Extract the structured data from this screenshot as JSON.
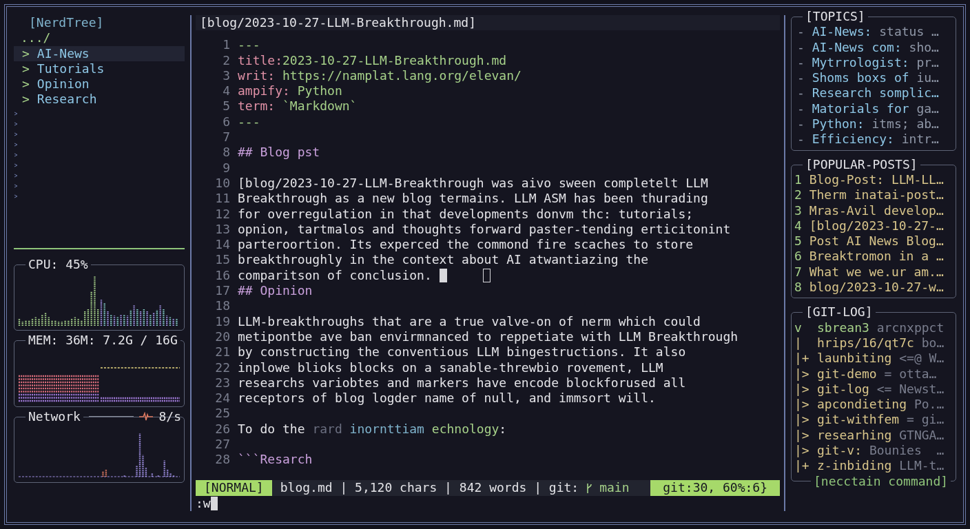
{
  "file_tree": {
    "title": "[NerdTree]",
    "parent": ".../",
    "items": [
      {
        "marker": ">",
        "label": "AI-News",
        "selected": true
      },
      {
        "marker": ">",
        "label": "Tutorials",
        "selected": false
      },
      {
        "marker": ">",
        "label": "Opinion",
        "selected": false
      },
      {
        "marker": ">",
        "label": "Research",
        "selected": false
      }
    ]
  },
  "monitors": [
    {
      "kind": "cpu",
      "title": "CPU: 45%"
    },
    {
      "kind": "mem",
      "title": "MEM: 36M: 7.2G / 16G"
    },
    {
      "kind": "network",
      "title": "Network",
      "reading": "8/s"
    }
  ],
  "editor": {
    "tab_title": "[blog/2023-10-27-LLM-Breakthrough.md]",
    "lines": [
      {
        "number": "1",
        "segments": [
          {
            "kind": "value",
            "text": "---"
          }
        ]
      },
      {
        "number": "2",
        "segments": [
          {
            "kind": "key",
            "text": "title:"
          },
          {
            "kind": "value",
            "text": "2023-10-27-LLM-Breakthrough.md"
          }
        ]
      },
      {
        "number": "3",
        "segments": [
          {
            "kind": "key",
            "text": "writ: "
          },
          {
            "kind": "value",
            "text": "https://namplat.lang.org/elevan/"
          }
        ]
      },
      {
        "number": "4",
        "segments": [
          {
            "kind": "key",
            "text": "ampify: "
          },
          {
            "kind": "value",
            "text": "Python"
          }
        ]
      },
      {
        "number": "5",
        "segments": [
          {
            "kind": "key",
            "text": "term: "
          },
          {
            "kind": "value",
            "text": "`Markdown`"
          }
        ]
      },
      {
        "number": "6",
        "segments": [
          {
            "kind": "value",
            "text": "---"
          }
        ]
      },
      {
        "number": "7"
      },
      {
        "number": "8",
        "segments": [
          {
            "kind": "heading",
            "text": "## Blog pst"
          }
        ]
      },
      {
        "number": "9"
      },
      {
        "number": "10",
        "segments": [
          {
            "kind": "text",
            "text": "[blog/2023-10-27-LLM-Breakthrough was aivo sween completelt LLM"
          }
        ]
      },
      {
        "number": "11",
        "segments": [
          {
            "kind": "text",
            "text": "Breakthrough as a new blog termains. LLM ASM has been thurading"
          }
        ]
      },
      {
        "number": "12",
        "segments": [
          {
            "kind": "text",
            "text": "for overregulation in that developments donvm thc: tutorials;"
          }
        ]
      },
      {
        "number": "13",
        "segments": [
          {
            "kind": "text",
            "text": "opnion, tartmalos and thoughts forward paster-tending erticitonint"
          }
        ]
      },
      {
        "number": "14",
        "segments": [
          {
            "kind": "text",
            "text": "parteroortion. Its experced the commond fire scaches to store"
          }
        ]
      },
      {
        "number": "15",
        "segments": [
          {
            "kind": "text",
            "text": "breakthroughly in the context about AI atwantiazing the"
          }
        ]
      },
      {
        "number": "16",
        "segments": [
          {
            "kind": "text",
            "text": "comparitson of conclusion. "
          },
          {
            "kind": "block-cursor"
          },
          {
            "kind": "hollow-cursor"
          }
        ]
      },
      {
        "number": "17",
        "segments": [
          {
            "kind": "heading",
            "text": "## Opinion"
          }
        ]
      },
      {
        "number": "18"
      },
      {
        "number": "19",
        "segments": [
          {
            "kind": "text",
            "text": "LLM-breakthroughs that are a true valve-on of nerm which could"
          }
        ]
      },
      {
        "number": "20",
        "segments": [
          {
            "kind": "text",
            "text": "metipontbe ave ban envirmnanced to reppetiate with LLM Breakthrough"
          }
        ]
      },
      {
        "number": "21",
        "segments": [
          {
            "kind": "text",
            "text": "by constructing the conventious LLM bingestructions. It also"
          }
        ]
      },
      {
        "number": "22",
        "segments": [
          {
            "kind": "text",
            "text": "inplowe blioks blocks on a sanable-threwbio rovement, LLM"
          }
        ]
      },
      {
        "number": "23",
        "segments": [
          {
            "kind": "text",
            "text": "researchs variobtes and markers have encode blockforused all"
          }
        ]
      },
      {
        "number": "24",
        "segments": [
          {
            "kind": "text",
            "text": "receptors of blog logder name of null, and immsort will."
          }
        ]
      },
      {
        "number": "25"
      },
      {
        "number": "26",
        "segments": [
          {
            "kind": "text",
            "text": "To do the "
          },
          {
            "kind": "faint",
            "text": "rard"
          },
          {
            "kind": "link",
            "text": " inornttiam"
          },
          {
            "kind": "value",
            "text": " echnology"
          },
          {
            "kind": "text",
            "text": ":"
          }
        ]
      },
      {
        "number": "27"
      },
      {
        "number": "28",
        "segments": [
          {
            "kind": "heading",
            "text": "```Resarch"
          }
        ]
      }
    ]
  },
  "status_bar": {
    "mode": "[NORMAL]",
    "info": "blog.md | 5,120 chars | 842 words | git:",
    "branch": "main",
    "position": "git:30, 60%:6}"
  },
  "command_line": {
    "text": ":w"
  },
  "topics": {
    "title": "[TOPICS]",
    "items": [
      {
        "marker": "-",
        "name": "AI-News:",
        "desc": "status …"
      },
      {
        "marker": "-",
        "name": "AI-News com:",
        "desc": "sho…"
      },
      {
        "marker": "-",
        "name": "Mytrrologist:",
        "desc": "pr…"
      },
      {
        "marker": "-",
        "name": "Shoms boxs of",
        "desc": "iu…"
      },
      {
        "marker": "-",
        "name": "Research somplic…"
      },
      {
        "marker": "-",
        "name": "Matorials for",
        "desc": "ga…"
      },
      {
        "marker": "-",
        "name": "Python:",
        "desc": "itms; ab…"
      },
      {
        "marker": "-",
        "name": "Efficiency:",
        "desc": "intr…"
      }
    ]
  },
  "popular_posts": {
    "title": "[POPULAR-POSTS]",
    "items": [
      {
        "number": "1",
        "text": "Blog-Post: LLM-LL…"
      },
      {
        "number": "2",
        "text": "Therm inatai-post…"
      },
      {
        "number": "3",
        "text": "Mras-Avil develop…"
      },
      {
        "number": "4",
        "text": "[blog/2023-10-27-…"
      },
      {
        "number": "5",
        "text": "Post AI News Blog…"
      },
      {
        "number": "6",
        "text": "Breaktromon in a …"
      },
      {
        "number": "7",
        "text": "What we we.ur am.…"
      },
      {
        "number": "8",
        "text": "blog/2023-10-27-w…"
      }
    ]
  },
  "git_log": {
    "title": "[GIT-LOG]",
    "items": [
      {
        "kind": "head",
        "graph": "v",
        "name": "sbrean3",
        "detail": "arcnxppct"
      },
      {
        "kind": "commit",
        "graph": "|",
        "name": "hrips/16/qt7c",
        "detail": "bo…"
      },
      {
        "kind": "commit",
        "graph": "|+",
        "name": "launbiting",
        "detail": "<=@ W…"
      },
      {
        "kind": "commit",
        "graph": "|>",
        "name": "git-demo",
        "detail": "= otta…"
      },
      {
        "kind": "commit",
        "graph": "|>",
        "name": "git-log",
        "detail": "<= Newst…"
      },
      {
        "kind": "commit",
        "graph": "|>",
        "name": "apcondieting",
        "detail": "Po.…"
      },
      {
        "kind": "commit",
        "graph": "|>",
        "name": "git-withfem",
        "detail": "= gi…"
      },
      {
        "kind": "commit",
        "graph": "|>",
        "name": "researhing",
        "detail": "GTNGA…"
      },
      {
        "kind": "commit",
        "graph": "|>",
        "name": "git-v:",
        "detail": "Bounies  …"
      },
      {
        "kind": "commit",
        "graph": "|+",
        "name": "z-inbiding",
        "detail": "LLM-t…"
      }
    ],
    "footer": "[necctain command]"
  }
}
